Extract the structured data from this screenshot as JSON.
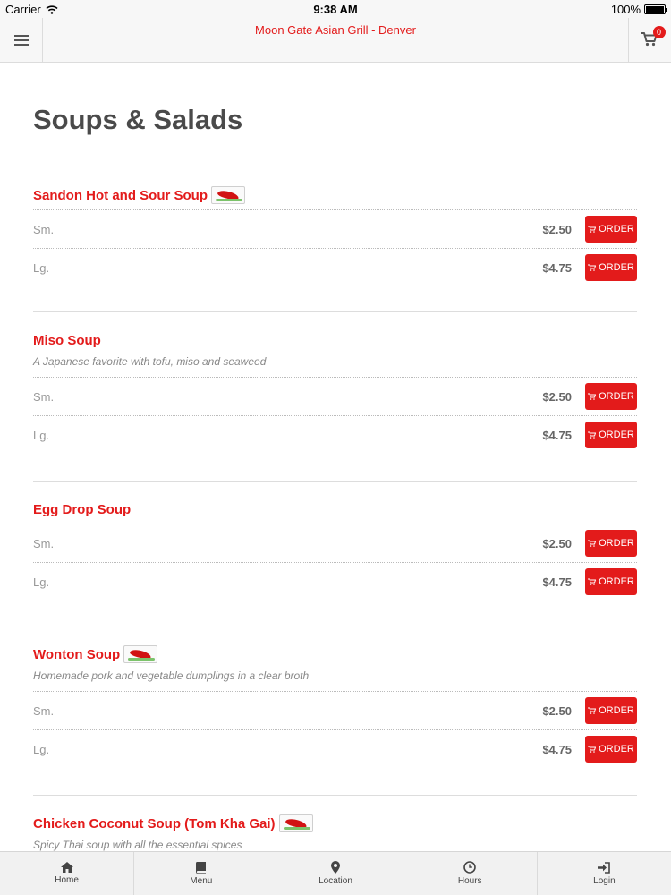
{
  "status_bar": {
    "carrier": "Carrier",
    "time": "9:38 AM",
    "battery": "100%"
  },
  "header": {
    "title": "Moon Gate Asian Grill - Denver",
    "cart_count": "0"
  },
  "page": {
    "title": "Soups & Salads"
  },
  "order_label": "ORDER",
  "items": [
    {
      "name": "Sandon Hot and Sour Soup",
      "spicy": true,
      "description": "",
      "sizes": [
        {
          "label": "Sm.",
          "price": "$2.50"
        },
        {
          "label": "Lg.",
          "price": "$4.75"
        }
      ]
    },
    {
      "name": "Miso Soup",
      "spicy": false,
      "description": "A Japanese favorite with tofu, miso and seaweed",
      "sizes": [
        {
          "label": "Sm.",
          "price": "$2.50"
        },
        {
          "label": "Lg.",
          "price": "$4.75"
        }
      ]
    },
    {
      "name": "Egg Drop Soup",
      "spicy": false,
      "description": "",
      "sizes": [
        {
          "label": "Sm.",
          "price": "$2.50"
        },
        {
          "label": "Lg.",
          "price": "$4.75"
        }
      ]
    },
    {
      "name": "Wonton Soup",
      "spicy": true,
      "description": "Homemade pork and vegetable dumplings in a clear broth",
      "sizes": [
        {
          "label": "Sm.",
          "price": "$2.50"
        },
        {
          "label": "Lg.",
          "price": "$4.75"
        }
      ]
    },
    {
      "name": "Chicken Coconut Soup (Tom Kha Gai)",
      "spicy": true,
      "description": "Spicy Thai soup with all the essential spices",
      "sizes": []
    }
  ],
  "tabs": [
    {
      "label": "Home",
      "icon": "home-icon"
    },
    {
      "label": "Menu",
      "icon": "book-icon"
    },
    {
      "label": "Location",
      "icon": "map-pin-icon"
    },
    {
      "label": "Hours",
      "icon": "clock-icon"
    },
    {
      "label": "Login",
      "icon": "login-icon"
    }
  ],
  "colors": {
    "accent": "#e31b1b",
    "title_text": "#4a4a4a",
    "bar_bg": "#f7f7f7"
  }
}
